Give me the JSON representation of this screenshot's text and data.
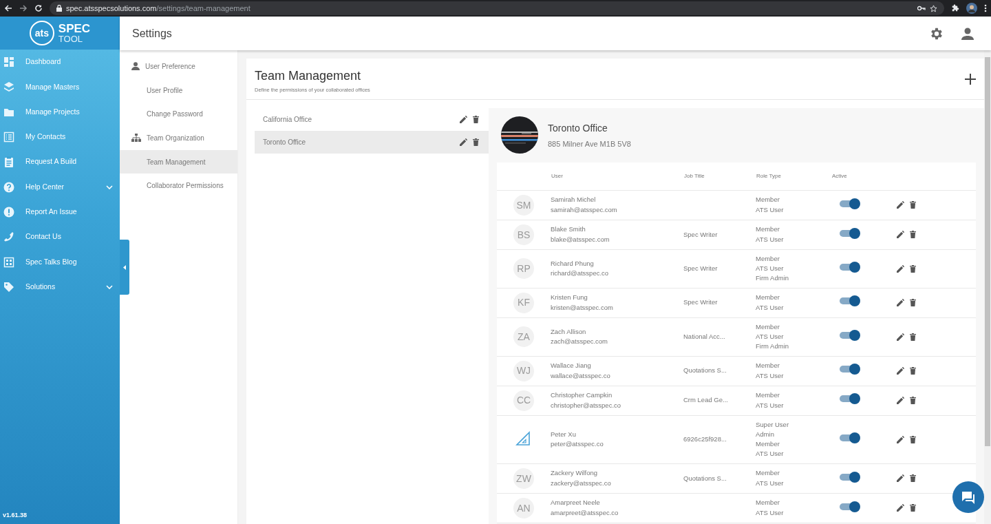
{
  "browser": {
    "url_host": "spec.atsspecsolutions.com",
    "url_path": "/settings/team-management"
  },
  "sidebar": {
    "logo": {
      "mark": "ats",
      "word": "SPEC",
      "subword": "TOOL"
    },
    "items": [
      {
        "label": "Dashboard",
        "expandable": false
      },
      {
        "label": "Manage Masters",
        "expandable": false
      },
      {
        "label": "Manage Projects",
        "expandable": false
      },
      {
        "label": "My Contacts",
        "expandable": false
      },
      {
        "label": "Request A Build",
        "expandable": false
      },
      {
        "label": "Help Center",
        "expandable": true
      },
      {
        "label": "Report An Issue",
        "expandable": false
      },
      {
        "label": "Contact Us",
        "expandable": false
      },
      {
        "label": "Spec Talks Blog",
        "expandable": false
      },
      {
        "label": "Solutions",
        "expandable": true
      }
    ],
    "version": "v1.61.38"
  },
  "header": {
    "title": "Settings"
  },
  "settings_menu": [
    {
      "label": "User Preference",
      "kind": "group",
      "selected": false
    },
    {
      "label": "User Profile",
      "kind": "link",
      "selected": false
    },
    {
      "label": "Change Password",
      "kind": "link",
      "selected": false
    },
    {
      "label": "Team Organization",
      "kind": "group",
      "selected": false
    },
    {
      "label": "Team Management",
      "kind": "link",
      "selected": true
    },
    {
      "label": "Collaborator Permissions",
      "kind": "link",
      "selected": false
    }
  ],
  "team": {
    "title": "Team Management",
    "subtitle": "Define the permissions of your collaborated offices",
    "offices": [
      {
        "name": "California Office",
        "selected": false
      },
      {
        "name": "Toronto Office",
        "selected": true
      }
    ],
    "detail": {
      "name": "Toronto Office",
      "address": "885 Milner Ave M1B 5V8"
    },
    "columns": [
      "User",
      "Job Title",
      "Role Type",
      "Active"
    ],
    "users": [
      {
        "avatar": {
          "kind": "initials",
          "text": "SM"
        },
        "name": "Samirah Michel",
        "email": "samirah@atsspec.com",
        "roles": [
          "Member",
          "ATS User"
        ],
        "active": true
      },
      {
        "avatar": {
          "kind": "initials",
          "text": "BS"
        },
        "name": "Blake Smith",
        "email": "blake@atsspec.com",
        "job_title": "Spec Writer",
        "roles": [
          "Member",
          "ATS User"
        ],
        "active": true
      },
      {
        "avatar": {
          "kind": "initials",
          "text": "RP"
        },
        "name": "Richard Phung",
        "email": "richard@atsspec.co",
        "job_title": "Spec Writer",
        "roles": [
          "Member",
          "ATS User",
          "Firm Admin"
        ],
        "active": true
      },
      {
        "avatar": {
          "kind": "initials",
          "text": "KF"
        },
        "name": "Kristen Fung",
        "email": "kristen@atsspec.com",
        "job_title": "Spec Writer",
        "roles": [
          "Member",
          "ATS User"
        ],
        "active": true
      },
      {
        "avatar": {
          "kind": "initials",
          "text": "ZA"
        },
        "name": "Zach Allison",
        "email": "zach@atsspec.com",
        "job_title": "National Acc...",
        "roles": [
          "Member",
          "ATS User",
          "Firm Admin"
        ],
        "active": true
      },
      {
        "avatar": {
          "kind": "initials",
          "text": "WJ"
        },
        "name": "Wallace Jiang",
        "email": "wallace@atsspec.co",
        "job_title": "Quotations S...",
        "roles": [
          "Member",
          "ATS User"
        ],
        "active": true
      },
      {
        "avatar": {
          "kind": "initials",
          "text": "CC"
        },
        "name": "Christopher Campkin",
        "email": "christopher@atsspec.co",
        "job_title": "Crm Lead Ge...",
        "roles": [
          "Member",
          "ATS User"
        ],
        "active": true
      },
      {
        "avatar": {
          "kind": "logo"
        },
        "name": "Peter Xu",
        "email": "peter@atsspec.co",
        "job_title": "6926c25f928...",
        "roles": [
          "Super User",
          "Admin",
          "Member",
          "ATS User"
        ],
        "active": true
      },
      {
        "avatar": {
          "kind": "initials",
          "text": "ZW"
        },
        "name": "Zackery Wilfong",
        "email": "zackery@atsspec.co",
        "job_title": "Quotations S...",
        "roles": [
          "Member",
          "ATS User"
        ],
        "active": true
      },
      {
        "avatar": {
          "kind": "initials",
          "text": "AN"
        },
        "name": "Amarpreet Neele",
        "email": "amarpreet@atsspec.co",
        "roles": [
          "Member",
          "ATS User"
        ],
        "active": true
      }
    ]
  }
}
